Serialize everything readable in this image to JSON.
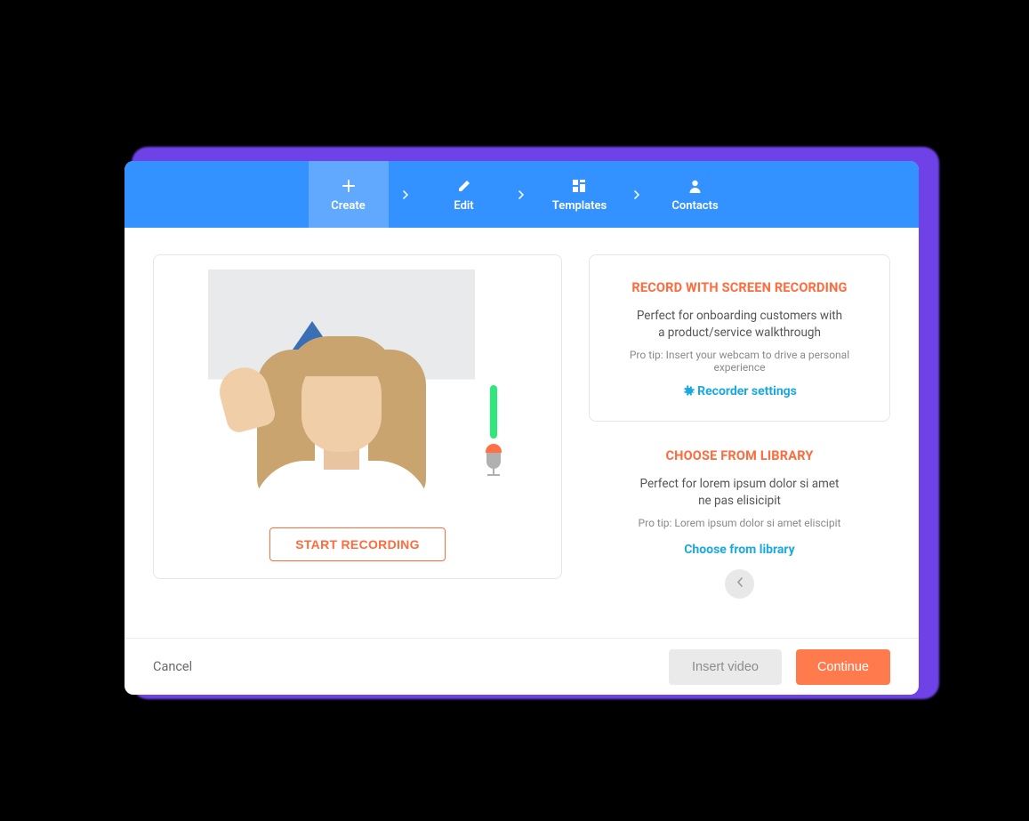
{
  "header": {
    "steps": [
      {
        "label": "Create"
      },
      {
        "label": "Edit"
      },
      {
        "label": "Templates"
      },
      {
        "label": "Contacts"
      }
    ]
  },
  "webcam": {
    "start_button": "START RECORDING"
  },
  "screen_recording": {
    "title": "RECORD WITH SCREEN RECORDING",
    "desc_line1": "Perfect for onboarding customers with",
    "desc_line2": "a product/service walkthrough",
    "tip": "Pro tip: Insert your webcam to drive a personal experience",
    "link": "Recorder settings"
  },
  "library": {
    "title": "CHOOSE FROM LIBRARY",
    "desc_line1": "Perfect for lorem ipsum dolor si amet",
    "desc_line2": "ne pas elisicipit",
    "tip": "Pro tip: Lorem ipsum dolor si amet eliscipit",
    "link": "Choose from library"
  },
  "footer": {
    "cancel": "Cancel",
    "insert": "Insert video",
    "continue": "Continue"
  }
}
